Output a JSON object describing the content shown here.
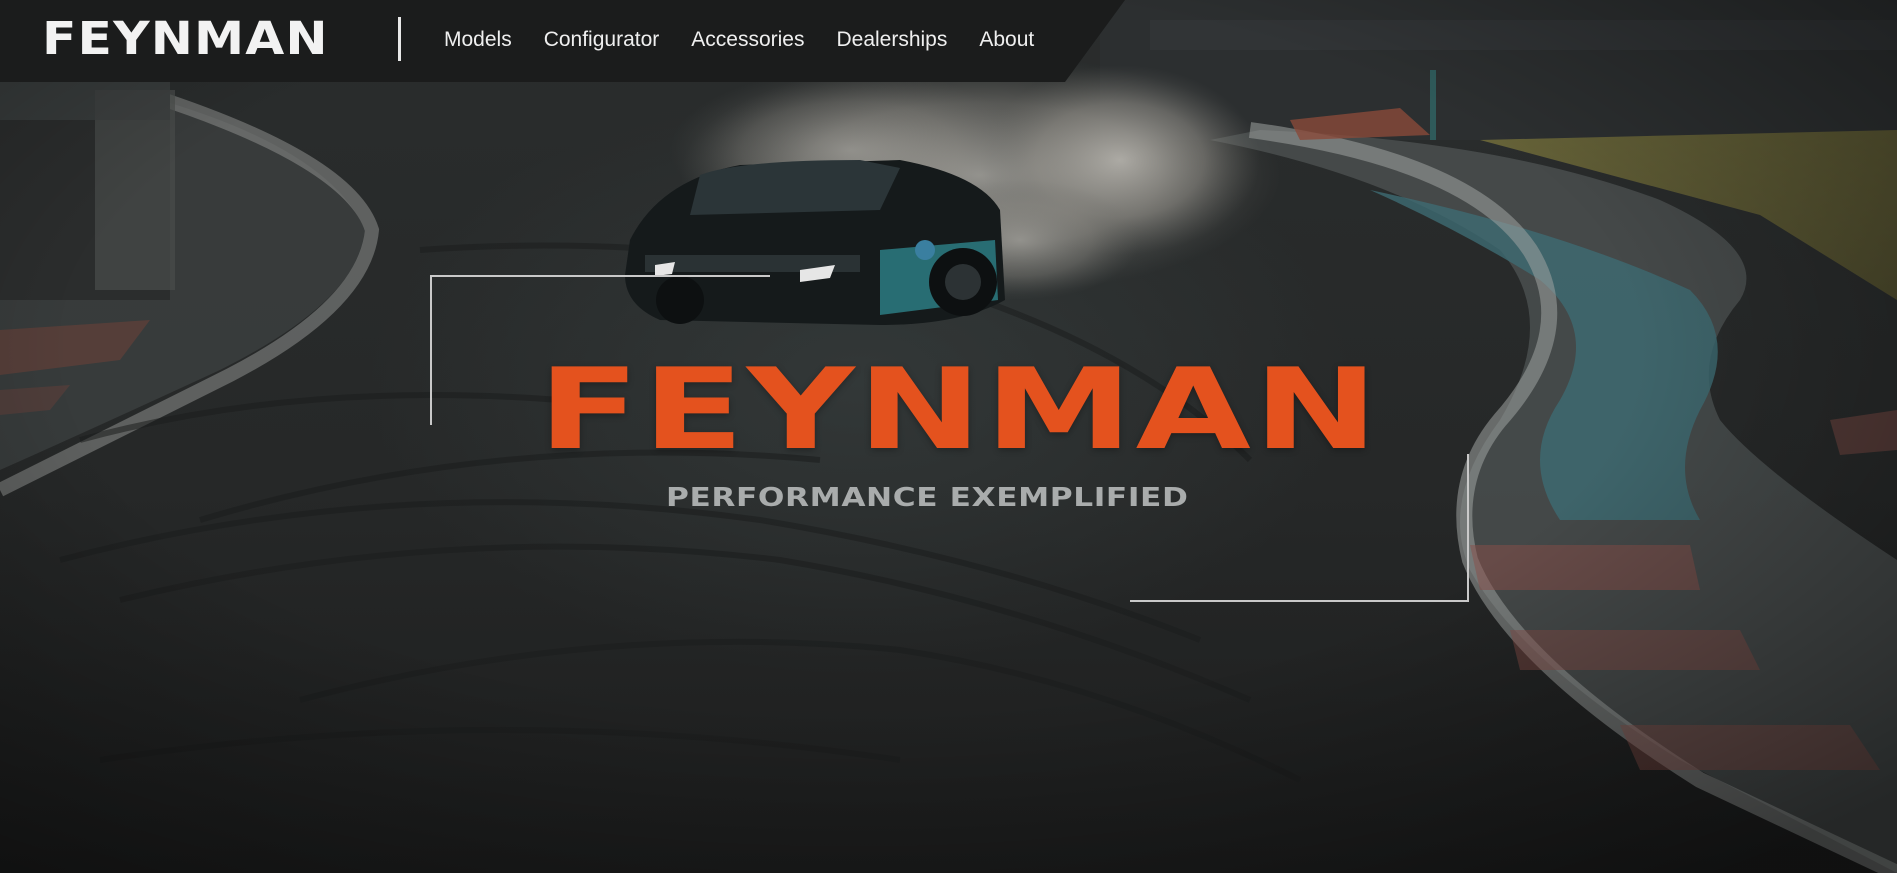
{
  "header": {
    "brand": "FEYNMAN",
    "nav": [
      {
        "label": "Models"
      },
      {
        "label": "Configurator"
      },
      {
        "label": "Accessories"
      },
      {
        "label": "Dealerships"
      },
      {
        "label": "About"
      }
    ]
  },
  "hero": {
    "title": "FEYNMAN",
    "subtitle": "PERFORMANCE EXEMPLIFIED"
  },
  "colors": {
    "accent": "#e4521e",
    "nav_background": "#1b1c1c",
    "subtitle": "#a9acac"
  }
}
